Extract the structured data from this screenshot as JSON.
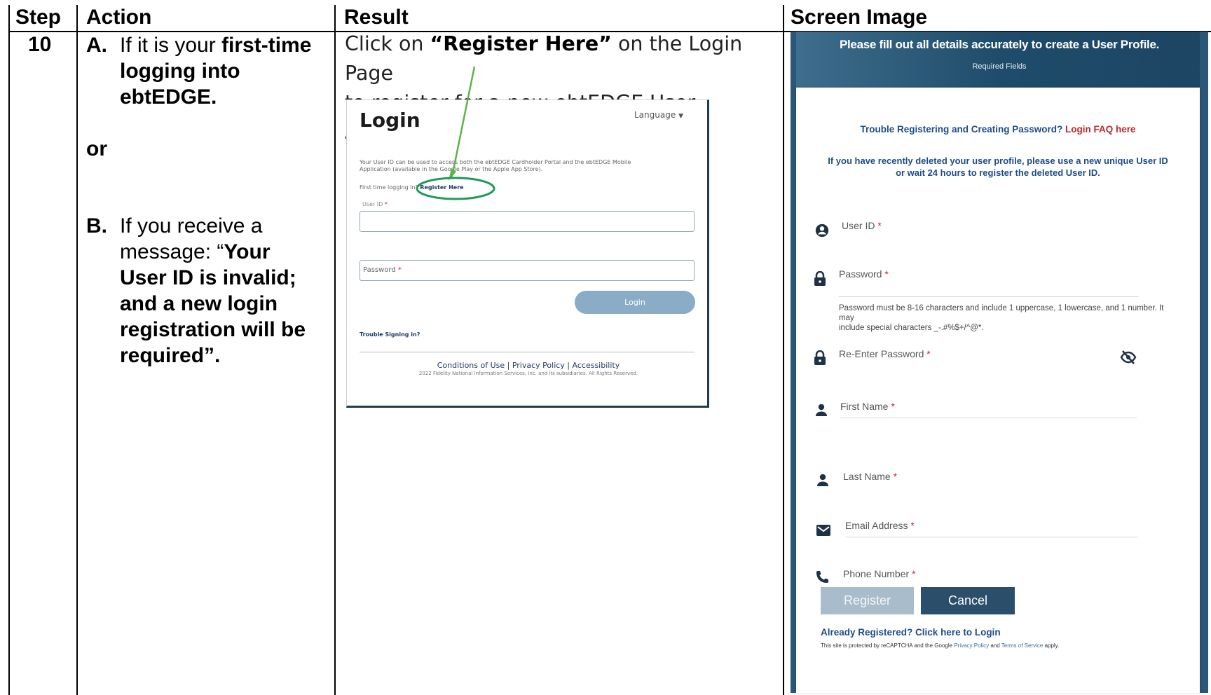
{
  "table": {
    "headers": {
      "step": "Step",
      "action": "Action",
      "result": "Result",
      "screen": "Screen Image"
    },
    "step_number": "10"
  },
  "action": {
    "a_marker": "A.",
    "a_text_plain": "If it is your ",
    "a_text_bold1": "first-time",
    "a_text_bold2": "logging into",
    "a_text_bold3": "ebtEDGE.",
    "or": "or",
    "b_marker": "B.",
    "b_line1": "If you receive a",
    "b_line2_plain": "message: “",
    "b_line2_bold": "Your",
    "b_line3": "User ID is invalid;",
    "b_line4": "and a new login",
    "b_line5": "registration will be",
    "b_line6": "required”."
  },
  "result": {
    "line1_plain": "Click on ",
    "line1_bold": "“Register Here”",
    "line1_end": " on the Login Page",
    "line2": "to register for a new ebtEDGE User Account."
  },
  "login_screen": {
    "language": "Language",
    "title": "Login",
    "desc_line1": "Your User ID can be used to access both the ebtEDGE Cardholder Portal and the ebtEDGE Mobile",
    "desc_line2": "Application (available in the Google Play or the Apple App Store).",
    "first_time": "First time logging in?",
    "register_here": "Register Here",
    "userid_label": "User ID",
    "password_label": "Password",
    "login_button": "Login",
    "trouble": "Trouble Signing in?",
    "footer_links": "Conditions of Use  |  Privacy Policy  |  Accessibility",
    "copyright": "2022 Fidelity National Information Services, Inc. and its subsidiaries. All Rights Reserved."
  },
  "register_screen": {
    "header": "Please fill out all details accurately to create a User Profile.",
    "required_fields": "Required Fields",
    "trouble": "Trouble Registering and Creating Password?",
    "faq_link": "Login FAQ here",
    "deleted_line1": "If you have recently deleted your user profile, please use a new unique User ID",
    "deleted_line2": "or wait 24 hours to register the deleted User ID.",
    "fields": {
      "user_id": "User ID",
      "password": "Password",
      "password_hint1": "Password must be 8-16 characters and include 1 uppercase, 1 lowercase, and 1 number. It may",
      "password_hint2": "include special characters _-.#%$+/^@*.",
      "reenter": "Re-Enter Password",
      "first_name": "First Name",
      "last_name": "Last Name",
      "email": "Email Address",
      "phone": "Phone Number"
    },
    "required_mark": "*",
    "register_button": "Register",
    "cancel_button": "Cancel",
    "already": "Already Registered? Click here to Login",
    "recaptcha_pre": "This site is protected by reCAPTCHA and the Google ",
    "privacy": "Privacy Policy",
    "and": " and ",
    "terms": "Terms of Service",
    "apply": " apply."
  },
  "colors": {
    "reg_header": "#1f4c6b",
    "login_button": "#8aacc6",
    "register_button": "#a9bccb",
    "cancel_button": "#2b4f6b",
    "highlight_circle": "#1e9b5a",
    "arrow": "#5fb14a",
    "link_red": "#c0282d",
    "reg_text_blue": "#1f4c86"
  }
}
